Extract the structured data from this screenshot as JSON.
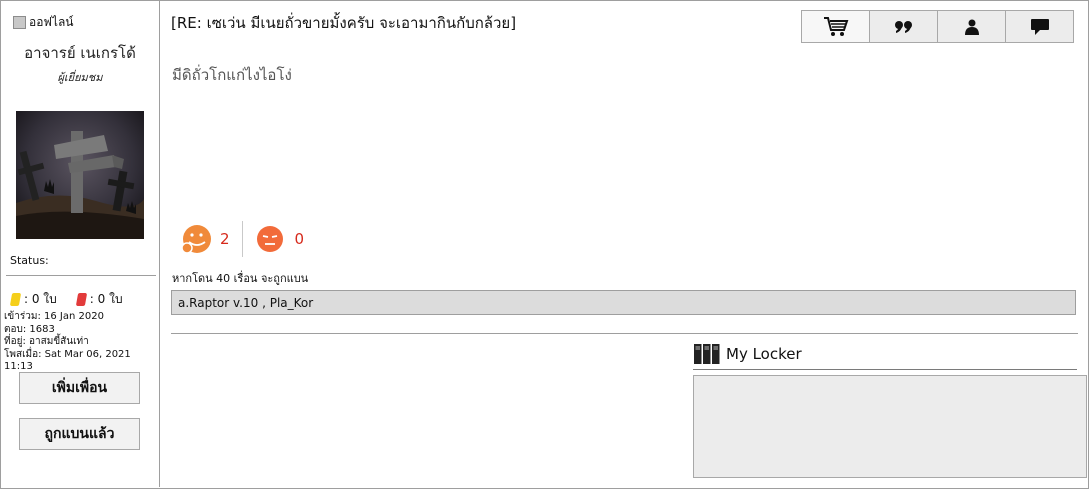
{
  "sidebar": {
    "online_status": "ออฟไลน์",
    "username": "อาจารย์ เนเกรโด้",
    "user_title": "ผู้เยี่ยมชม",
    "status_label": "Status:",
    "yellow_cards": ": 0 ใบ",
    "red_cards": ": 0 ใบ",
    "joined": "เข้าร่วม: 16 Jan 2020",
    "replies": "ตอบ: 1683",
    "location": "ที่อยู่: อาสมขี้สันเท่า",
    "posted": "โพสเมื่อ: Sat Mar 06, 2021 11:13",
    "add_friend_label": "เพิ่มเพื่อน",
    "banned_label": "ถูกแบนแล้ว"
  },
  "post": {
    "title": "[RE: เซเว่น มีเนยถั่วขายมั้งครับ จะเอามากินกับกล้วย]",
    "body": "มีดิถั่วโกแก่ไงไอโง่",
    "tabs": [
      {
        "icon": "cart-icon"
      },
      {
        "icon": "quote-icon"
      },
      {
        "icon": "user-icon"
      },
      {
        "icon": "message-icon"
      }
    ]
  },
  "reactions": {
    "like_count": "2",
    "dislike_count": "0",
    "colors": {
      "like": "#f08a3a",
      "dislike": "#f26b3a",
      "count": "#d62a1c"
    }
  },
  "signature": {
    "text": "หากโดน 40 เรื่อน จะถูกแบน",
    "box": "a.Raptor v.10 , Pla_Kor"
  },
  "locker": {
    "title": "My Locker"
  }
}
